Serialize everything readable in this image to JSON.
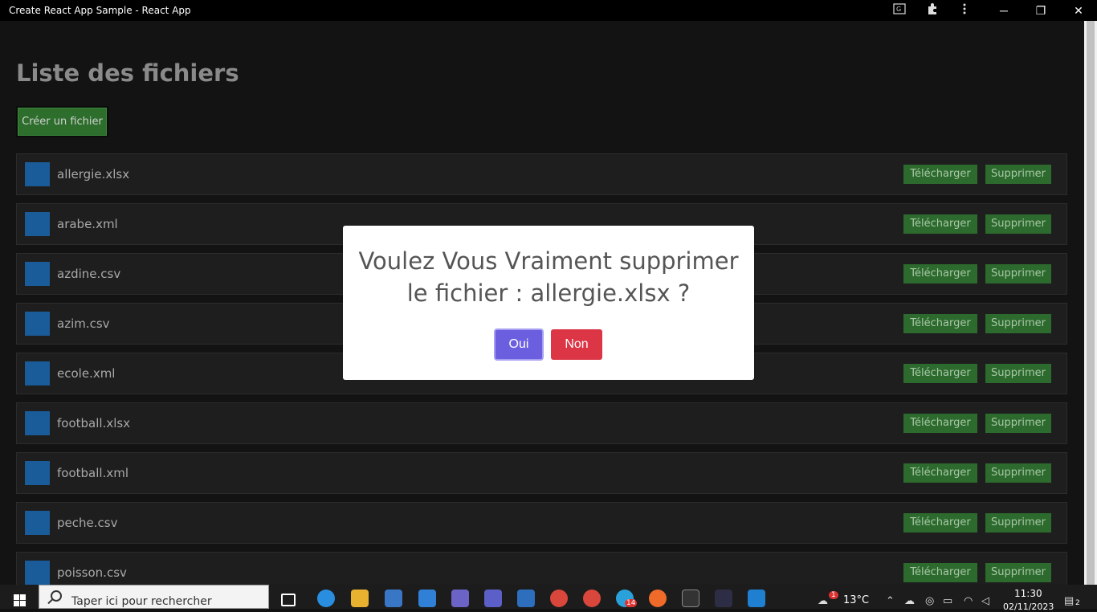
{
  "window": {
    "title": "Create React App Sample - React App",
    "minimize": "─",
    "restore": "❐",
    "close": "✕"
  },
  "page": {
    "title": "Liste des fichiers",
    "create_button": "Créer un fichier"
  },
  "files": [
    {
      "name": "allergie.xlsx"
    },
    {
      "name": "arabe.xml"
    },
    {
      "name": "azdine.csv"
    },
    {
      "name": "azim.csv"
    },
    {
      "name": "ecole.xml"
    },
    {
      "name": "football.xlsx"
    },
    {
      "name": "football.xml"
    },
    {
      "name": "peche.csv"
    },
    {
      "name": "poisson.csv"
    }
  ],
  "row_buttons": {
    "download": "Télécharger",
    "delete": "Supprimer"
  },
  "modal": {
    "line1": "Voulez Vous Vraiment supprimer",
    "line2": "le fichier : allergie.xlsx ?",
    "confirm": "Oui",
    "cancel": "Non"
  },
  "taskbar": {
    "search_placeholder": "Taper ici pour rechercher",
    "weather_badge": "1",
    "temperature": "13°C",
    "time": "11:30",
    "date": "02/11/2023",
    "telegram_badge": "14",
    "notification_count": "2"
  },
  "colors": {
    "file_icon": "#1a5c99",
    "action_green": "#2d6a2d",
    "confirm_purple": "#6b5fe0",
    "cancel_red": "#dc3545"
  }
}
